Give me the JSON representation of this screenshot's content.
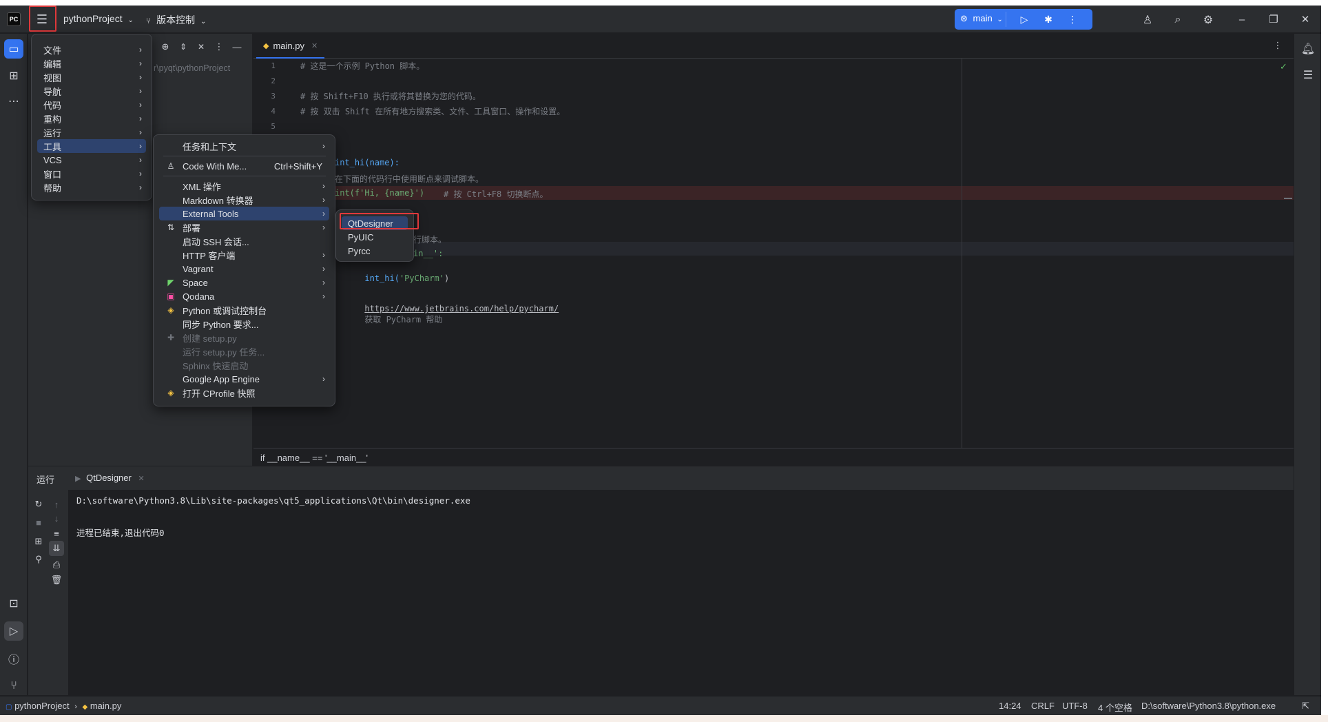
{
  "titlebar": {
    "project": "pythonProject",
    "vcs": "版本控制",
    "branch": "main"
  },
  "main_menu": [
    {
      "label": "文件"
    },
    {
      "label": "编辑"
    },
    {
      "label": "视图"
    },
    {
      "label": "导航"
    },
    {
      "label": "代码"
    },
    {
      "label": "重构"
    },
    {
      "label": "运行"
    },
    {
      "label": "工具",
      "selected": true
    },
    {
      "label": "VCS"
    },
    {
      "label": "窗口"
    },
    {
      "label": "帮助"
    }
  ],
  "tools_menu": {
    "items": [
      {
        "label": "任务和上下文"
      },
      {
        "label": "Code With Me...",
        "shortcut": "Ctrl+Shift+Y"
      },
      {
        "label": "XML 操作"
      },
      {
        "label": "Markdown 转换器"
      },
      {
        "label": "External Tools",
        "selected": true
      },
      {
        "label": "部署"
      },
      {
        "label": "启动 SSH 会话..."
      },
      {
        "label": "HTTP 客户端"
      },
      {
        "label": "Vagrant"
      },
      {
        "label": "Space"
      },
      {
        "label": "Qodana"
      },
      {
        "label": "Python 或调试控制台"
      },
      {
        "label": "同步 Python 要求..."
      },
      {
        "label": "创建 setup.py",
        "disabled": true
      },
      {
        "label": "运行 setup.py 任务...",
        "disabled": true
      },
      {
        "label": "Sphinx 快速启动",
        "disabled": true
      },
      {
        "label": "Google App Engine"
      },
      {
        "label": "打开 CProfile 快照"
      }
    ]
  },
  "external_tools_menu": [
    {
      "label": "QtDesigner",
      "selected": true
    },
    {
      "label": "PyUIC"
    },
    {
      "label": "Pyrcc"
    }
  ],
  "project_panel": {
    "path": "r\\pyqt\\pythonProject"
  },
  "editor": {
    "tab": "main.py",
    "lines": [
      {
        "n": "1",
        "text": "# 这是一个示例 Python 脚本。"
      },
      {
        "n": "2",
        "text": ""
      },
      {
        "n": "3",
        "text": "# 按 Shift+F10 执行或将其替换为您的代码。"
      },
      {
        "n": "4",
        "text": "# 按 双击 Shift 在所有地方搜索类、文件、工具窗口、操作和设置。"
      },
      {
        "n": "5",
        "text": ""
      }
    ],
    "def_line": "int_hi(name):",
    "comment_line": "在下面的代码行中使用断点来调试脚本。",
    "print_call": "int(f'Hi, {name}')",
    "print_comment": "# 按 Ctrl+F8 切换断点。",
    "frag_comment": "行脚本。",
    "frag_main": "in__':",
    "call_line_pre": "int_hi(",
    "call_arg": "'PyCharm'",
    "call_line_post": ")",
    "help_url": "https://www.jetbrains.com/help/pycharm/",
    "help_text": "获取 PyCharm 帮助",
    "breadcrumb": "if __name__ == '__main__'"
  },
  "run_panel": {
    "title": "运行",
    "tab": "QtDesigner",
    "output_line1": "D:\\software\\Python3.8\\Lib\\site-packages\\qt5_applications\\Qt\\bin\\designer.exe",
    "output_line2": "进程已结束,退出代码0"
  },
  "statusbar": {
    "project": "pythonProject",
    "file": "main.py",
    "position": "14:24",
    "line_sep": "CRLF",
    "encoding": "UTF-8",
    "indent": "4 个空格",
    "interpreter": "D:\\software\\Python3.8\\python.exe"
  },
  "colors": {
    "accent": "#3574f0",
    "highlight_box": "#e0393b",
    "menu_selection": "#2e436e",
    "breakpoint_line": "#3b2426"
  }
}
